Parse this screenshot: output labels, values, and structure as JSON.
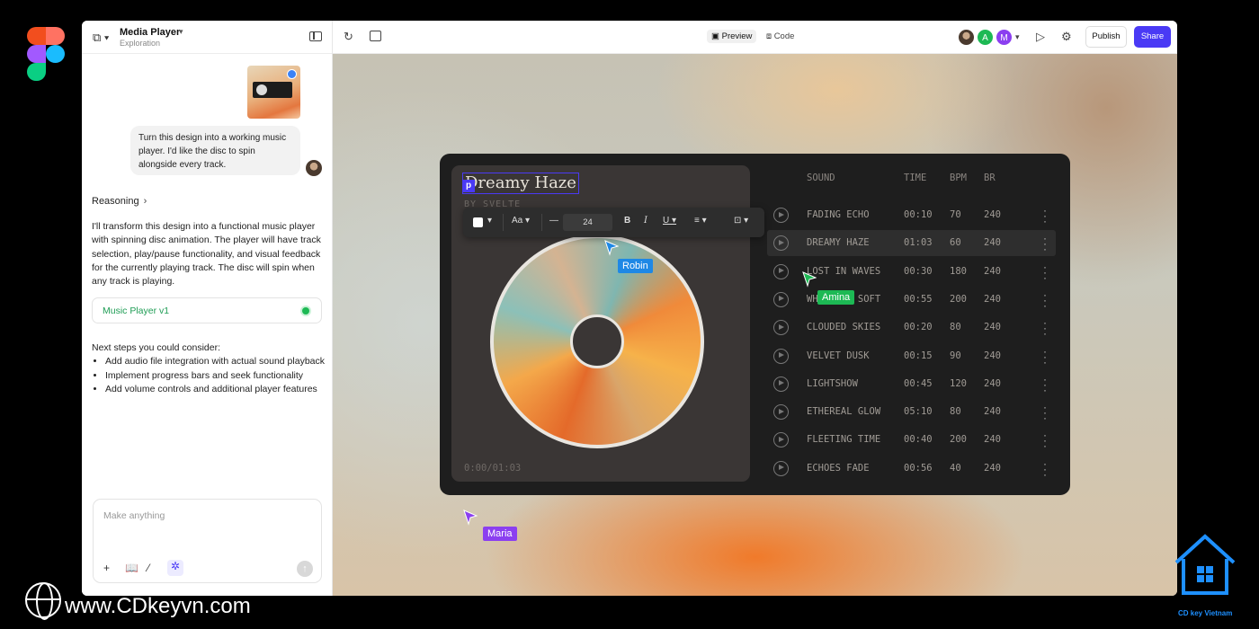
{
  "project": {
    "title": "Media Player",
    "subtitle": "Exploration"
  },
  "chat": {
    "user_message": "Turn this design into a working music player. I'd like the disc to spin alongside every track.",
    "reasoning_label": "Reasoning",
    "ai_message": "I'll transform this design into a functional music player with spinning disc animation. The player will have track selection, play/pause functionality, and visual feedback for the currently playing track. The disc will spin when any track is playing.",
    "version_label": "Music Player v1",
    "next_steps_title": "Next steps you could consider:",
    "next_steps": [
      "Add audio file integration with actual sound playback",
      "Implement progress bars and seek functionality",
      "Add volume controls and additional player features"
    ],
    "composer_placeholder": "Make anything"
  },
  "topbar": {
    "preview_label": "Preview",
    "code_label": "Code",
    "avatar_a": "A",
    "avatar_m": "M",
    "publish_label": "Publish",
    "share_label": "Share"
  },
  "player": {
    "title": "Dreamy Haze",
    "artist": "BY SVELTE",
    "time": "0:00/01:03",
    "font_size": "24",
    "headers": {
      "sound": "SOUND",
      "time": "TIME",
      "bpm": "BPM",
      "br": "BR"
    },
    "tracks": [
      {
        "name": "FADING ECHO",
        "time": "00:10",
        "bpm": "70",
        "br": "240"
      },
      {
        "name": "DREAMY HAZE",
        "time": "01:03",
        "bpm": "60",
        "br": "240"
      },
      {
        "name": "LOST IN WAVES",
        "time": "00:30",
        "bpm": "180",
        "br": "240"
      },
      {
        "name": "WHISPERS SOFT",
        "time": "00:55",
        "bpm": "200",
        "br": "240"
      },
      {
        "name": "CLOUDED SKIES",
        "time": "00:20",
        "bpm": "80",
        "br": "240"
      },
      {
        "name": "VELVET DUSK",
        "time": "00:15",
        "bpm": "90",
        "br": "240"
      },
      {
        "name": "LIGHTSHOW",
        "time": "00:45",
        "bpm": "120",
        "br": "240"
      },
      {
        "name": "ETHEREAL GLOW",
        "time": "05:10",
        "bpm": "80",
        "br": "240"
      },
      {
        "name": "FLEETING TIME",
        "time": "00:40",
        "bpm": "200",
        "br": "240"
      },
      {
        "name": "ECHOES FADE",
        "time": "00:56",
        "bpm": "40",
        "br": "240"
      }
    ],
    "active_index": 1
  },
  "cursors": {
    "robin": "Robin",
    "amina": "Amina",
    "maria": "Maria",
    "p_badge": "p"
  },
  "colors": {
    "accent": "#4a3af5",
    "robin": "#1e88e5",
    "amina": "#1db954",
    "maria": "#8b3ff0"
  },
  "watermark": {
    "site": "www.CDkeyvn.com",
    "label": "CD key Vietnam"
  }
}
